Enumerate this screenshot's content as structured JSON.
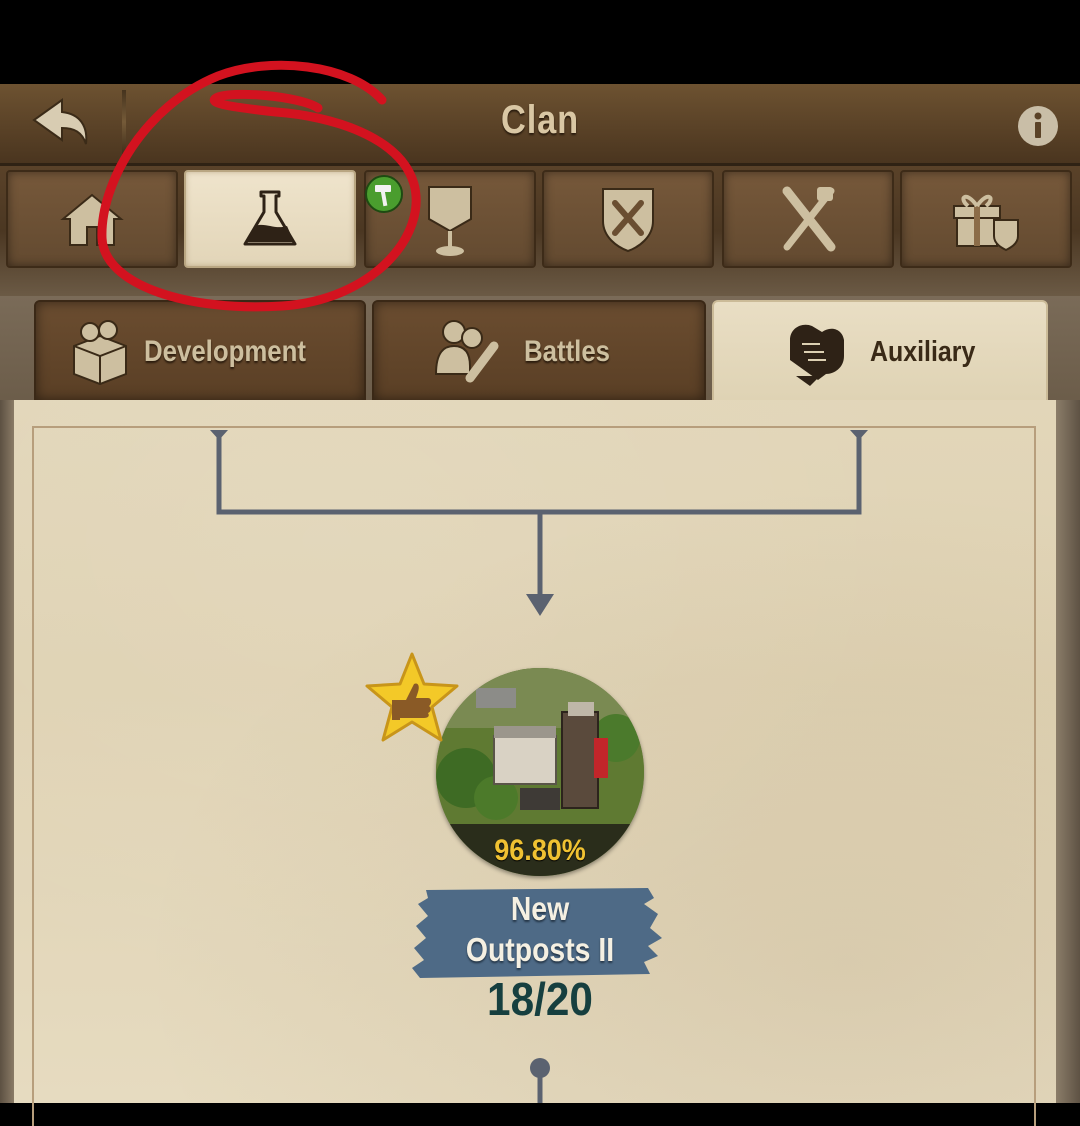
{
  "header": {
    "title": "Clan",
    "back_icon": "back-arrow-icon",
    "info_icon": "info-icon"
  },
  "main_tabs": [
    {
      "icon": "home-icon",
      "active": false
    },
    {
      "icon": "flask-icon",
      "active": true
    },
    {
      "icon": "banner-trophy-icon",
      "active": false,
      "badge": "hammer-icon"
    },
    {
      "icon": "battle-shield-icon",
      "active": false
    },
    {
      "icon": "crossed-weapons-icon",
      "active": false
    },
    {
      "icon": "gift-icon",
      "active": false
    }
  ],
  "sub_tabs": [
    {
      "label": "Development",
      "icon": "supplies-crate-icon",
      "active": false
    },
    {
      "label": "Battles",
      "icon": "fighters-icon",
      "active": false
    },
    {
      "label": "Auxiliary",
      "icon": "handshake-icon",
      "active": true
    }
  ],
  "research_node": {
    "progress": "96.80%",
    "name_line1": "New",
    "name_line2": "Outposts II",
    "level": "18/20",
    "badge_icon": "recommended-star-icon"
  },
  "colors": {
    "accent_gold": "#f0c232",
    "banner_blue": "#4e6a86",
    "annotation_red": "#d3121f",
    "level_text": "#163f3f"
  }
}
